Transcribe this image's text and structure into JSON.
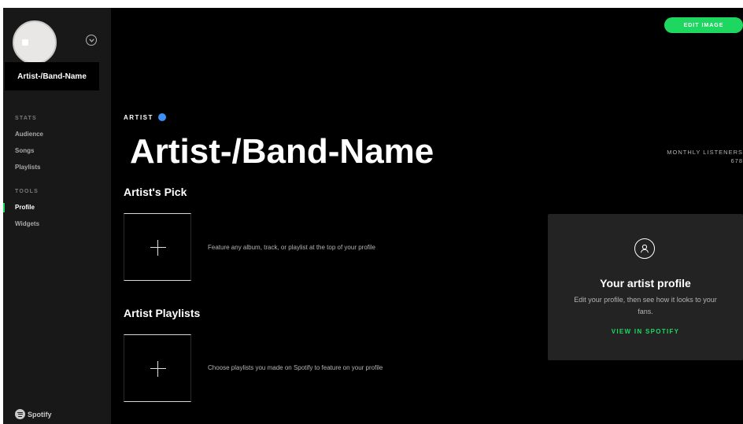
{
  "sidebar": {
    "artist_name": "Artist-/Band-Name",
    "stats_label": "STATS",
    "stats_items": [
      "Audience",
      "Songs",
      "Playlists"
    ],
    "tools_label": "TOOLS",
    "tools_items": [
      "Profile",
      "Widgets"
    ],
    "active_item": "Profile",
    "logo_text": "Spotify"
  },
  "header": {
    "edit_button": "EDIT IMAGE",
    "artist_tag": "ARTIST",
    "title": "Artist-/Band-Name",
    "monthly_listeners_label": "MONTHLY LISTENERS",
    "monthly_listeners_value": "678"
  },
  "artists_pick": {
    "title": "Artist's Pick",
    "hint": "Feature any album, track, or playlist at the top of your profile"
  },
  "artist_playlists": {
    "title": "Artist Playlists",
    "hint": "Choose playlists you made on Spotify to feature on your profile"
  },
  "profile_card": {
    "title": "Your artist profile",
    "description": "Edit your profile, then see how it looks to your fans.",
    "link": "VIEW IN SPOTIFY"
  },
  "colors": {
    "accent": "#1ed760",
    "verified": "#3d91f4",
    "sidebar_bg": "#181818",
    "main_bg": "#000000",
    "card_bg": "#232323"
  },
  "icons": {
    "avatar": "avatar-image",
    "menu": "chevron-down-icon",
    "verified": "verified-badge-icon",
    "add": "plus-icon",
    "profile": "user-profile-icon",
    "logo": "spotify-logo-icon"
  }
}
